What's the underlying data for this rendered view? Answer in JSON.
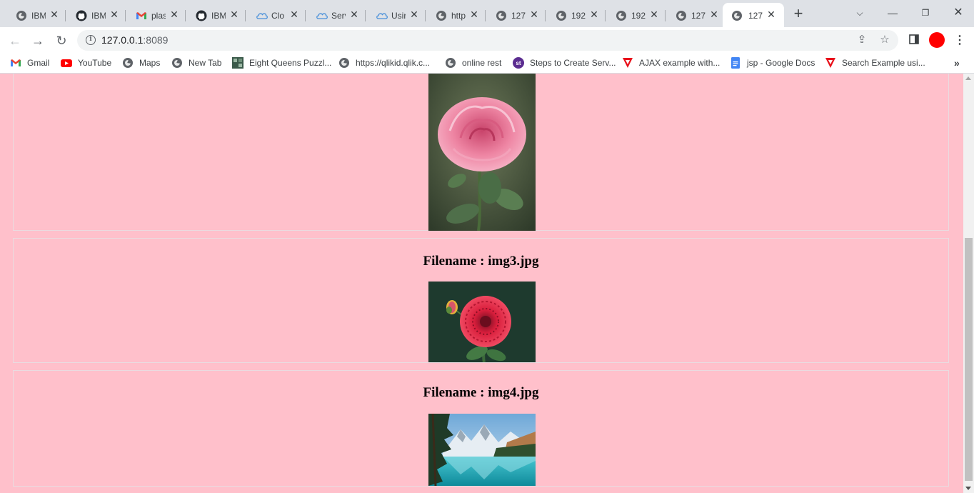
{
  "tabs": [
    {
      "label": "IBM",
      "icon": "globe-icon"
    },
    {
      "label": "IBM",
      "icon": "github-icon"
    },
    {
      "label": "plas",
      "icon": "gmail-icon"
    },
    {
      "label": "IBM",
      "icon": "github-icon"
    },
    {
      "label": "Clo",
      "icon": "cloud-icon"
    },
    {
      "label": "Serv",
      "icon": "cloud-icon"
    },
    {
      "label": "Usir",
      "icon": "cloud-icon"
    },
    {
      "label": "http",
      "icon": "globe-icon"
    },
    {
      "label": "127",
      "icon": "globe-icon"
    },
    {
      "label": "192",
      "icon": "globe-icon"
    },
    {
      "label": "192",
      "icon": "globe-icon"
    },
    {
      "label": "127",
      "icon": "globe-icon"
    },
    {
      "label": "127",
      "icon": "globe-icon",
      "active": true
    }
  ],
  "address_bar": {
    "host": "127.0.0.1",
    "port": ":8089"
  },
  "bookmarks": [
    {
      "label": "Gmail",
      "icon": "gmail-icon"
    },
    {
      "label": "YouTube",
      "icon": "youtube-icon"
    },
    {
      "label": "Maps",
      "icon": "globe-icon"
    },
    {
      "label": "New Tab",
      "icon": "globe-icon"
    },
    {
      "label": "Eight Queens Puzzl...",
      "icon": "puzzle-icon"
    },
    {
      "label": "https://qlikid.qlik.c...",
      "icon": "globe-icon"
    },
    {
      "label": "online rest",
      "icon": "globe-icon"
    },
    {
      "label": "Steps to Create Serv...",
      "icon": "st-icon"
    },
    {
      "label": "AJAX example with...",
      "icon": "warning-icon"
    },
    {
      "label": "jsp - Google Docs",
      "icon": "docs-icon"
    },
    {
      "label": "Search Example usi...",
      "icon": "warning-icon"
    }
  ],
  "files": [
    {
      "filename_label": "Filename : img3.jpg",
      "image": "red dahlia flower"
    },
    {
      "filename_label": "Filename : img4.jpg",
      "image": "mountain lake landscape"
    }
  ],
  "colors": {
    "page_background": "#ffc0cb",
    "tab_strip": "#dee1e6",
    "profile_avatar": "#ff0000"
  }
}
